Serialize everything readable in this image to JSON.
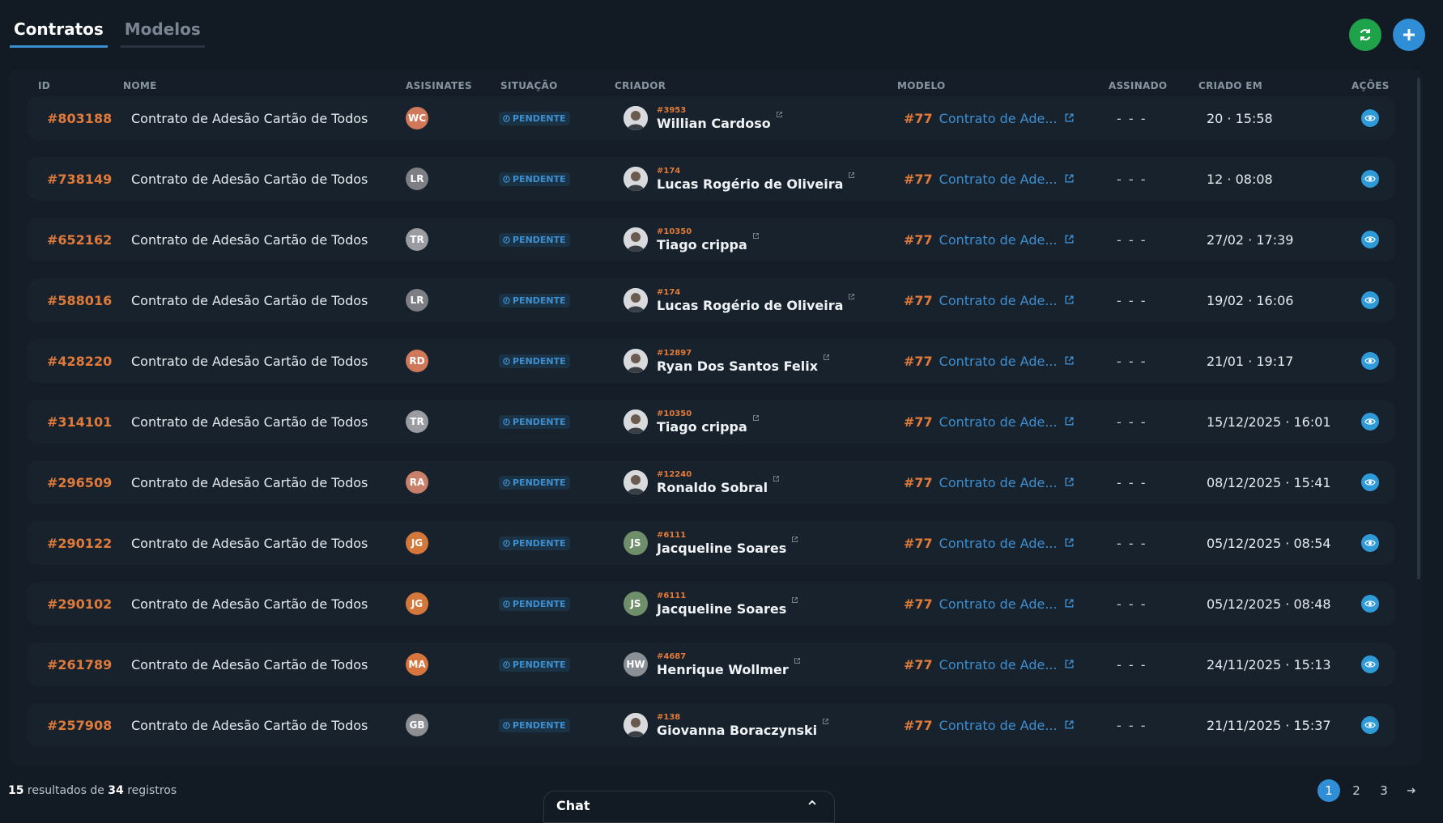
{
  "tabs": [
    {
      "label": "Contratos",
      "active": true
    },
    {
      "label": "Modelos",
      "active": false
    }
  ],
  "header_buttons": {
    "refresh_icon": "refresh-icon",
    "add_icon": "plus-icon"
  },
  "columns": {
    "id": "ID",
    "name": "NOME",
    "signers": "ASISINATES",
    "status": "SITUAÇÃO",
    "creator": "CRIADOR",
    "model": "MODELO",
    "signed": "ASSINADO",
    "created_at": "CRIADO EM",
    "actions": "AÇÕES"
  },
  "rows": [
    {
      "id": "#803188",
      "name": "Contrato de Adesão Cartão de Todos",
      "signer_initials": "WC",
      "signer_color": "#d0795a",
      "status": "PENDENTE",
      "creator_id": "#3953",
      "creator_name": "Willian Cardoso",
      "creator_avatar": "photo",
      "model_num": "#77",
      "model_name": "Contrato de Ade...",
      "signed": "- - -",
      "created_at": "20 · 15:58"
    },
    {
      "id": "#738149",
      "name": "Contrato de Adesão Cartão de Todos",
      "signer_initials": "LR",
      "signer_color": "#7d7f84",
      "status": "PENDENTE",
      "creator_id": "#174",
      "creator_name": "Lucas Rogério de Oliveira",
      "creator_avatar": "photo",
      "model_num": "#77",
      "model_name": "Contrato de Ade...",
      "signed": "- - -",
      "created_at": "12 · 08:08"
    },
    {
      "id": "#652162",
      "name": "Contrato de Adesão Cartão de Todos",
      "signer_initials": "TR",
      "signer_color": "#9a9ca1",
      "status": "PENDENTE",
      "creator_id": "#10350",
      "creator_name": "Tiago crippa",
      "creator_avatar": "photo",
      "model_num": "#77",
      "model_name": "Contrato de Ade...",
      "signed": "- - -",
      "created_at": "27/02 · 17:39"
    },
    {
      "id": "#588016",
      "name": "Contrato de Adesão Cartão de Todos",
      "signer_initials": "LR",
      "signer_color": "#7d7f84",
      "status": "PENDENTE",
      "creator_id": "#174",
      "creator_name": "Lucas Rogério de Oliveira",
      "creator_avatar": "photo",
      "model_num": "#77",
      "model_name": "Contrato de Ade...",
      "signed": "- - -",
      "created_at": "19/02 · 16:06"
    },
    {
      "id": "#428220",
      "name": "Contrato de Adesão Cartão de Todos",
      "signer_initials": "RD",
      "signer_color": "#d0795a",
      "status": "PENDENTE",
      "creator_id": "#12897",
      "creator_name": "Ryan Dos Santos Felix",
      "creator_avatar": "photo",
      "model_num": "#77",
      "model_name": "Contrato de Ade...",
      "signed": "- - -",
      "created_at": "21/01 · 19:17"
    },
    {
      "id": "#314101",
      "name": "Contrato de Adesão Cartão de Todos",
      "signer_initials": "TR",
      "signer_color": "#9a9ca1",
      "status": "PENDENTE",
      "creator_id": "#10350",
      "creator_name": "Tiago crippa",
      "creator_avatar": "photo",
      "model_num": "#77",
      "model_name": "Contrato de Ade...",
      "signed": "- - -",
      "created_at": "15/12/2025 · 16:01"
    },
    {
      "id": "#296509",
      "name": "Contrato de Adesão Cartão de Todos",
      "signer_initials": "RA",
      "signer_color": "#c9806a",
      "status": "PENDENTE",
      "creator_id": "#12240",
      "creator_name": "Ronaldo Sobral",
      "creator_avatar": "photo",
      "model_num": "#77",
      "model_name": "Contrato de Ade...",
      "signed": "- - -",
      "created_at": "08/12/2025 · 15:41"
    },
    {
      "id": "#290122",
      "name": "Contrato de Adesão Cartão de Todos",
      "signer_initials": "JG",
      "signer_color": "#d4773a",
      "status": "PENDENTE",
      "creator_id": "#6111",
      "creator_name": "Jacqueline Soares",
      "creator_avatar": "JS",
      "creator_avatar_color": "#6e8f6a",
      "model_num": "#77",
      "model_name": "Contrato de Ade...",
      "signed": "- - -",
      "created_at": "05/12/2025 · 08:54"
    },
    {
      "id": "#290102",
      "name": "Contrato de Adesão Cartão de Todos",
      "signer_initials": "JG",
      "signer_color": "#d4773a",
      "status": "PENDENTE",
      "creator_id": "#6111",
      "creator_name": "Jacqueline Soares",
      "creator_avatar": "JS",
      "creator_avatar_color": "#6e8f6a",
      "model_num": "#77",
      "model_name": "Contrato de Ade...",
      "signed": "- - -",
      "created_at": "05/12/2025 · 08:48"
    },
    {
      "id": "#261789",
      "name": "Contrato de Adesão Cartão de Todos",
      "signer_initials": "MA",
      "signer_color": "#d8753e",
      "status": "PENDENTE",
      "creator_id": "#4687",
      "creator_name": "Henrique Wollmer",
      "creator_avatar": "HW",
      "creator_avatar_color": "#8b9096",
      "model_num": "#77",
      "model_name": "Contrato de Ade...",
      "signed": "- - -",
      "created_at": "24/11/2025 · 15:13"
    },
    {
      "id": "#257908",
      "name": "Contrato de Adesão Cartão de Todos",
      "signer_initials": "GB",
      "signer_color": "#8e8f93",
      "status": "PENDENTE",
      "creator_id": "#138",
      "creator_name": "Giovanna Boraczynski",
      "creator_avatar": "photo",
      "model_num": "#77",
      "model_name": "Contrato de Ade...",
      "signed": "- - -",
      "created_at": "21/11/2025 · 15:37"
    }
  ],
  "footer": {
    "shown": "15",
    "mid": " resultados de ",
    "total": "34",
    "suffix": " registros"
  },
  "chat": {
    "label": "Chat",
    "toggle_icon": "chevron-up-icon"
  },
  "pagination": {
    "pages": [
      "1",
      "2",
      "3"
    ],
    "current": "1",
    "next_icon": "arrow-right-icon"
  },
  "colors": {
    "accent_orange": "#e07a3a",
    "accent_blue": "#3d8fd0",
    "background": "#121a23"
  }
}
